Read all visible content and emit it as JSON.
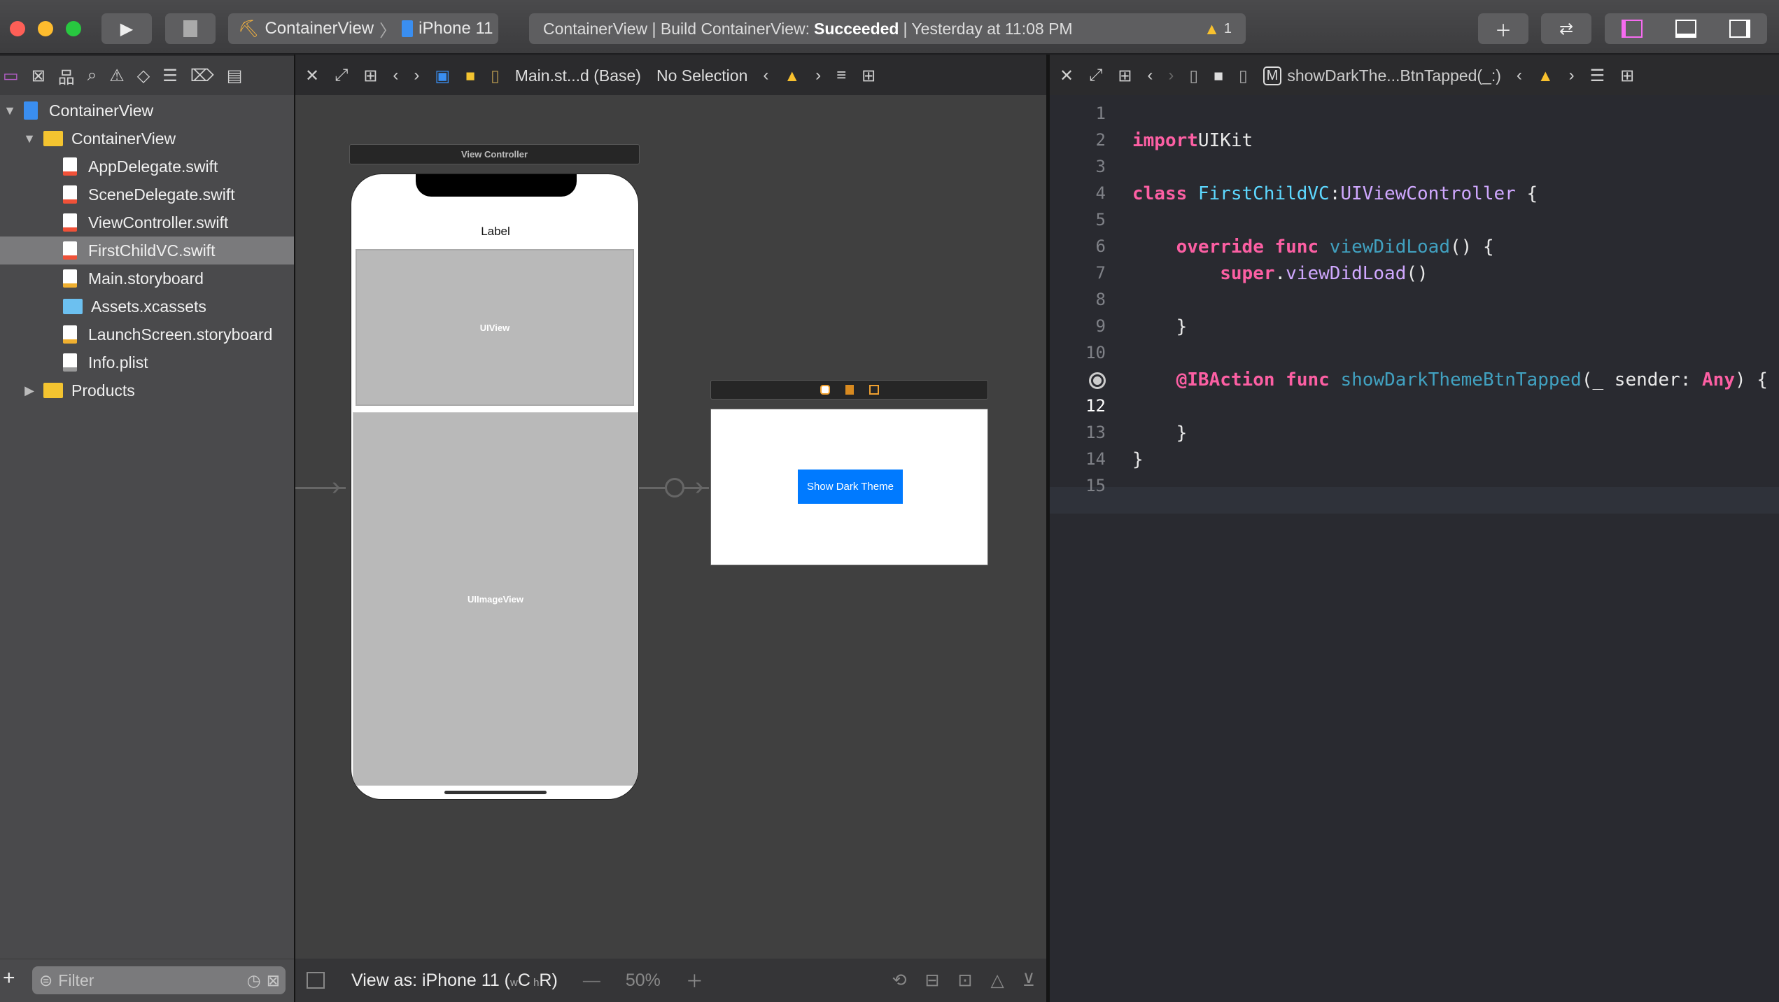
{
  "toolbar": {
    "scheme": "ContainerView",
    "device": "iPhone 11",
    "activity_prefix": "ContainerView | Build ContainerView:",
    "activity_status": "Succeeded",
    "activity_time": "| Yesterday at 11:08 PM",
    "warning_count": "1",
    "accent": "#f66bf0"
  },
  "storyboard_jump": {
    "file": "Main.st...d (Base)",
    "selection": "No Selection"
  },
  "code_jump": {
    "symbol": "showDarkThe...BtnTapped(_:)",
    "badge": "M"
  },
  "navigator": {
    "items": [
      {
        "label": "ContainerView",
        "kind": "project",
        "level": 0,
        "disclosure": "open"
      },
      {
        "label": "ContainerView",
        "kind": "folder",
        "level": 1,
        "disclosure": "open"
      },
      {
        "label": "AppDelegate.swift",
        "kind": "swift",
        "level": 2
      },
      {
        "label": "SceneDelegate.swift",
        "kind": "swift",
        "level": 2
      },
      {
        "label": "ViewController.swift",
        "kind": "swift",
        "level": 2
      },
      {
        "label": "FirstChildVC.swift",
        "kind": "swift",
        "level": 2,
        "selected": true
      },
      {
        "label": "Main.storyboard",
        "kind": "storyboard",
        "level": 2
      },
      {
        "label": "Assets.xcassets",
        "kind": "assets",
        "level": 2
      },
      {
        "label": "LaunchScreen.storyboard",
        "kind": "storyboard",
        "level": 2
      },
      {
        "label": "Info.plist",
        "kind": "plist",
        "level": 2
      },
      {
        "label": "Products",
        "kind": "folder",
        "level": 1,
        "disclosure": "closed"
      }
    ],
    "filter_placeholder": "Filter"
  },
  "storyboard": {
    "vc_title": "View Controller",
    "label": "Label",
    "uiview": "UIView",
    "uiimageview": "UIImageView",
    "button": "Show Dark Theme",
    "button_color": "#007aff"
  },
  "bottom": {
    "view_as": "View as: iPhone 11 (",
    "w": "w",
    "c": "C",
    "h": " h",
    "r": "R)",
    "zoom": "50%"
  },
  "code": {
    "current_line": 12,
    "lines": [
      {
        "n": "1",
        "t": []
      },
      {
        "n": "2",
        "t": [
          [
            "kw",
            "import"
          ],
          [
            "",
            "UIKit"
          ]
        ]
      },
      {
        "n": "3",
        "t": []
      },
      {
        "n": "4",
        "t": [
          [
            "kw",
            "class"
          ],
          [
            "ty",
            "FirstChildVC"
          ],
          [
            "",
            ":"
          ],
          [
            "sy",
            "UIViewController"
          ],
          [
            "",
            " {"
          ]
        ]
      },
      {
        "n": "5",
        "t": []
      },
      {
        "n": "6",
        "t": [
          [
            "",
            "    "
          ],
          [
            "kw",
            "override"
          ],
          [
            "kw",
            " func"
          ],
          [
            "fn",
            " viewDidLoad"
          ],
          [
            "",
            "() {"
          ]
        ]
      },
      {
        "n": "7",
        "t": [
          [
            "",
            "        "
          ],
          [
            "kw",
            "super"
          ],
          [
            "",
            "."
          ],
          [
            "sy",
            "viewDidLoad"
          ],
          [
            "",
            "()"
          ]
        ]
      },
      {
        "n": "8",
        "t": []
      },
      {
        "n": "9",
        "t": [
          [
            "",
            "    }"
          ]
        ]
      },
      {
        "n": "10",
        "t": []
      },
      {
        "n": "",
        "t": [
          [
            "",
            "    "
          ],
          [
            "kw",
            "@IBAction"
          ],
          [
            "kw",
            " func"
          ],
          [
            "fn",
            " showDarkThemeBtnTapped"
          ],
          [
            "",
            "(_ sender: "
          ],
          [
            "kw",
            "Any"
          ],
          [
            "",
            ") {"
          ]
        ]
      },
      {
        "n": "12",
        "t": []
      },
      {
        "n": "13",
        "t": [
          [
            "",
            "    }"
          ]
        ]
      },
      {
        "n": "14",
        "t": [
          [
            "",
            "}"
          ]
        ]
      },
      {
        "n": "15",
        "t": []
      }
    ]
  }
}
